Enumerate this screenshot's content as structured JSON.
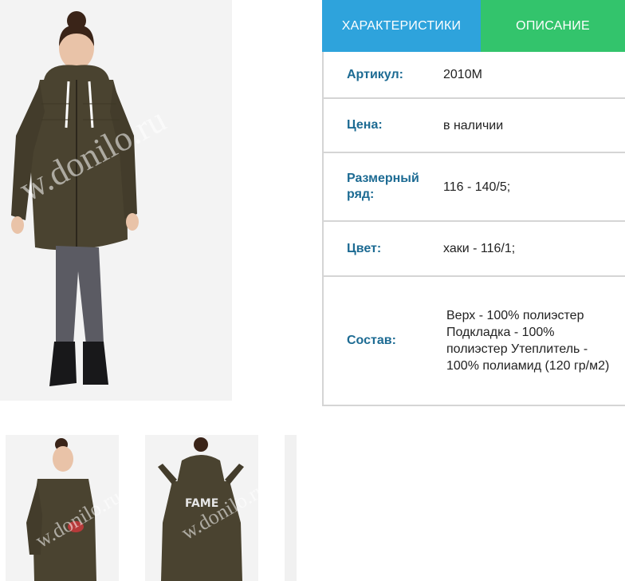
{
  "gallery": {
    "main_image": "girl-in-khaki-parka-front",
    "thumbnails": [
      "girl-in-khaki-parka-side",
      "girl-in-khaki-parka-back",
      "thumbnail-partial"
    ],
    "watermark": "w.donilo.ru"
  },
  "tabs": [
    {
      "label": "ХАРАКТЕРИСТИКИ",
      "active": true
    },
    {
      "label": "ОПИСАНИЕ",
      "active": false
    }
  ],
  "specs": [
    {
      "label": "Артикул:",
      "value": "2010M"
    },
    {
      "label": "Цена:",
      "value": "в наличии"
    },
    {
      "label": "Размерный ряд:",
      "value": "116 - 140/5;"
    },
    {
      "label": "Цвет:",
      "value": "хаки - 116/1;"
    },
    {
      "label": "Состав:",
      "value": "Верх - 100% полиэстер Подкладка - 100% полиэстер Утеплитель - 100% полиамид (120 гр/м2)"
    }
  ],
  "colors": {
    "tab_characteristics": "#2ea3dc",
    "tab_description": "#33c46c",
    "label_text": "#1d6b93",
    "border": "#d5d5d5",
    "jacket_khaki": "#4a4330"
  }
}
